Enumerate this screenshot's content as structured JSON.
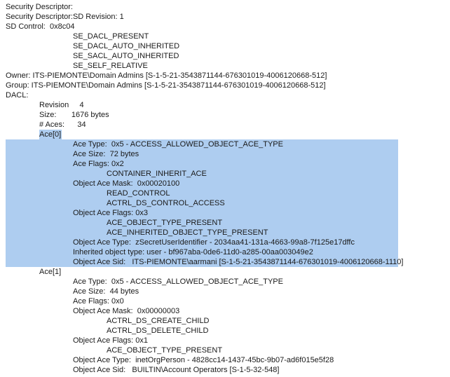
{
  "lines": [
    "Security Descriptor:",
    "Security Descriptor:SD Revision: 1",
    "SD Control:  0x8c04",
    "SE_DACL_PRESENT",
    "SE_DACL_AUTO_INHERITED",
    "SE_SACL_AUTO_INHERITED",
    "SE_SELF_RELATIVE",
    "Owner: ITS-PIEMONTE\\Domain Admins [S-1-5-21-3543871144-676301019-4006120668-512]",
    "Group: ITS-PIEMONTE\\Domain Admins [S-1-5-21-3543871144-676301019-4006120668-512]",
    "DACL:",
    "Revision     4",
    "Size:       1676 bytes",
    "# Aces:      34",
    "Ace[0]",
    "Ace Type:  0x5 - ACCESS_ALLOWED_OBJECT_ACE_TYPE",
    "Ace Size:  72 bytes",
    "Ace Flags: 0x2",
    "CONTAINER_INHERIT_ACE",
    "Object Ace Mask:  0x00020100",
    "READ_CONTROL",
    "ACTRL_DS_CONTROL_ACCESS",
    "Object Ace Flags: 0x3",
    "ACE_OBJECT_TYPE_PRESENT",
    "ACE_INHERITED_OBJECT_TYPE_PRESENT",
    "Object Ace Type:  zSecretUserIdentifier - 2034aa41-131a-4663-99a8-7f125e17dffc",
    "Inherited object type: user - bf967aba-0de6-11d0-a285-00aa003049e2",
    "Object Ace Sid:   ITS-PIEMONTE\\aarmani [S-1-5-21-3543871144-676301019-4006120668-1110]",
    "Ace[1]",
    "Ace Type:  0x5 - ACCESS_ALLOWED_OBJECT_ACE_TYPE",
    "Ace Size:  44 bytes",
    "Ace Flags: 0x0",
    "Object Ace Mask:  0x00000003",
    "ACTRL_DS_CREATE_CHILD",
    "ACTRL_DS_DELETE_CHILD",
    "Object Ace Flags: 0x1",
    "ACE_OBJECT_TYPE_PRESENT",
    "Object Ace Type:  inetOrgPerson - 4828cc14-1437-45bc-9b07-ad6f015e5f28",
    "Object Ace Sid:   BUILTIN\\Account Operators [S-1-5-32-548]"
  ],
  "selection_color": "#aecdf0"
}
